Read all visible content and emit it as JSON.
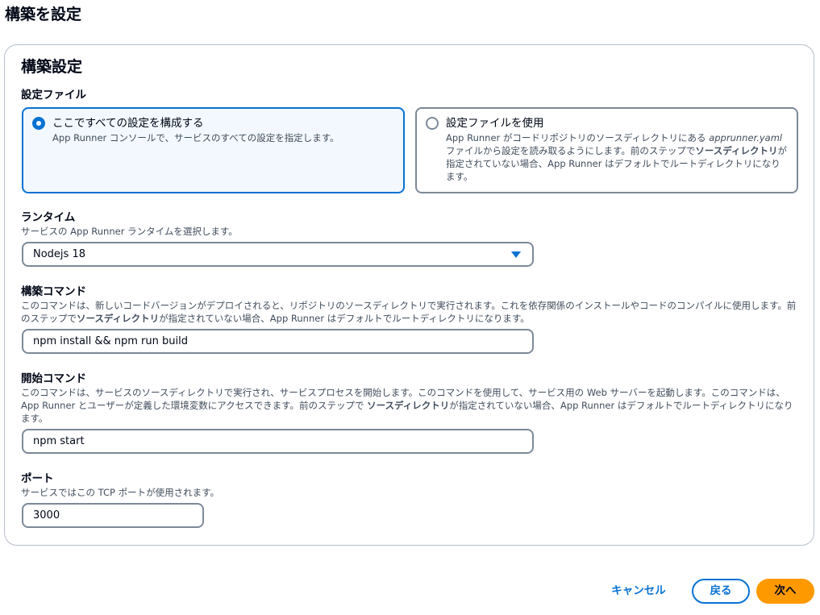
{
  "page_title": "構築を設定",
  "panel": {
    "title": "構築設定",
    "config_file": {
      "label": "設定ファイル",
      "options": [
        {
          "title": "ここですべての設定を構成する",
          "description": "App Runner コンソールで、サービスのすべての設定を指定します。",
          "selected": true
        },
        {
          "title": "設定ファイルを使用",
          "description_parts": [
            "App Runner がコードリポジトリのソースディレクトリにある ",
            "apprunner.yaml",
            " ファイルから設定を読み取るようにします。前のステップで",
            "ソースディレクトリ",
            "が指定されていない場合、App Runner はデフォルトでルートディレクトリになります。"
          ],
          "selected": false
        }
      ]
    },
    "runtime": {
      "label": "ランタイム",
      "description": "サービスの App Runner ランタイムを選択します。",
      "value": "Nodejs 18"
    },
    "build_command": {
      "label": "構築コマンド",
      "description_parts": [
        "このコマンドは、新しいコードバージョンがデプロイされると、リポジトリのソースディレクトリで実行されます。これを依存関係のインストールやコードのコンパイルに使用します。前のステップで",
        "ソースディレクトリ",
        "が指定されていない場合、App Runner はデフォルトでルートディレクトリになります。"
      ],
      "value": "npm install && npm run build"
    },
    "start_command": {
      "label": "開始コマンド",
      "description_parts": [
        "このコマンドは、サービスのソースディレクトリで実行され、サービスプロセスを開始します。このコマンドを使用して、サービス用の Web サーバーを起動します。このコマンドは、App Runner とユーザーが定義した環境変数にアクセスできます。前のステップで ",
        "ソースディレクトリ",
        "が指定されていない場合、App Runner はデフォルトでルートディレクトリになります。"
      ],
      "value": "npm start"
    },
    "port": {
      "label": "ポート",
      "description": "サービスではこの TCP ポートが使用されます。",
      "value": "3000"
    }
  },
  "actions": {
    "cancel": "キャンセル",
    "back": "戻る",
    "next": "次へ"
  },
  "colors": {
    "accent": "#0972d3",
    "primary_button": "#ff9900",
    "border": "#7d8998"
  }
}
